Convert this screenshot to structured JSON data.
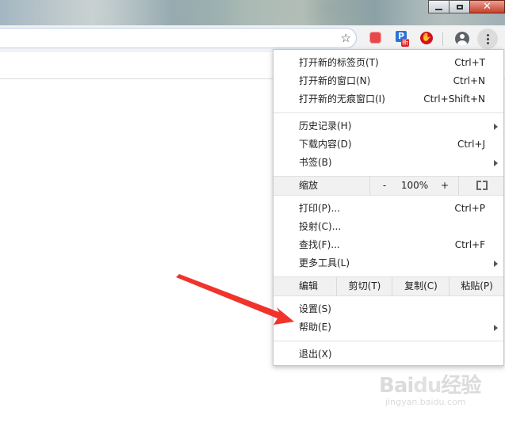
{
  "menu": {
    "new_tab": {
      "label": "打开新的标签页(T)",
      "shortcut": "Ctrl+T"
    },
    "new_window": {
      "label": "打开新的窗口(N)",
      "shortcut": "Ctrl+N"
    },
    "new_incognito": {
      "label": "打开新的无痕窗口(I)",
      "shortcut": "Ctrl+Shift+N"
    },
    "history": {
      "label": "历史记录(H)"
    },
    "downloads": {
      "label": "下载内容(D)",
      "shortcut": "Ctrl+J"
    },
    "bookmarks": {
      "label": "书签(B)"
    },
    "zoom": {
      "label": "缩放",
      "minus": "-",
      "value": "100%",
      "plus": "+"
    },
    "print": {
      "label": "打印(P)...",
      "shortcut": "Ctrl+P"
    },
    "cast": {
      "label": "投射(C)..."
    },
    "find": {
      "label": "查找(F)...",
      "shortcut": "Ctrl+F"
    },
    "more_tools": {
      "label": "更多工具(L)"
    },
    "edit": {
      "label": "编辑",
      "cut": "剪切(T)",
      "copy": "复制(C)",
      "paste": "粘贴(P)"
    },
    "settings": {
      "label": "设置(S)"
    },
    "help": {
      "label": "帮助(E)"
    },
    "exit": {
      "label": "退出(X)"
    }
  },
  "toolbar": {
    "ext2_letter": "P",
    "ext2_badge": "新",
    "ext3_glyph": "✋"
  },
  "watermark": {
    "logo_left": "Bai",
    "logo_mid": "du",
    "logo_right": "经验",
    "sub": "jingyan.baidu.com"
  },
  "icons": [
    "minimize-icon",
    "maximize-icon",
    "close-icon",
    "star-icon",
    "avatar-icon",
    "kebab-menu-icon",
    "submenu-arrow-icon",
    "fullscreen-icon"
  ],
  "colors": {
    "annotation_arrow": "#f0342c",
    "omnibox_border": "#b7cdf0"
  }
}
